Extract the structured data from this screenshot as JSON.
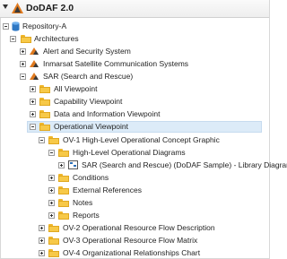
{
  "app": {
    "title": "DoDAF 2.0"
  },
  "tree": [
    {
      "label": "Repository-A"
    },
    {
      "label": "Architectures"
    },
    {
      "label": "Alert and Security System"
    },
    {
      "label": "Inmarsat Satellite Communication Systems"
    },
    {
      "label": "SAR (Search and Rescue)"
    },
    {
      "label": "All Viewpoint"
    },
    {
      "label": "Capability Viewpoint"
    },
    {
      "label": "Data and Information Viewpoint"
    },
    {
      "label": "Operational Viewpoint"
    },
    {
      "label": "OV-1 High-Level Operational Concept Graphic"
    },
    {
      "label": "High-Level Operational Diagrams"
    },
    {
      "label": "SAR (Search and Rescue) (DoDAF Sample) - Library Diagram"
    },
    {
      "label": "Conditions"
    },
    {
      "label": "External References"
    },
    {
      "label": "Notes"
    },
    {
      "label": "Reports"
    },
    {
      "label": "OV-2 Operational Resource Flow Description"
    },
    {
      "label": "OV-3 Operational Resource Flow Matrix"
    },
    {
      "label": "OV-4 Organizational Relationships Chart"
    }
  ],
  "colors": {
    "selection": "#dcebf8",
    "folder": "#f7c948",
    "accent": "#e07a1f"
  }
}
